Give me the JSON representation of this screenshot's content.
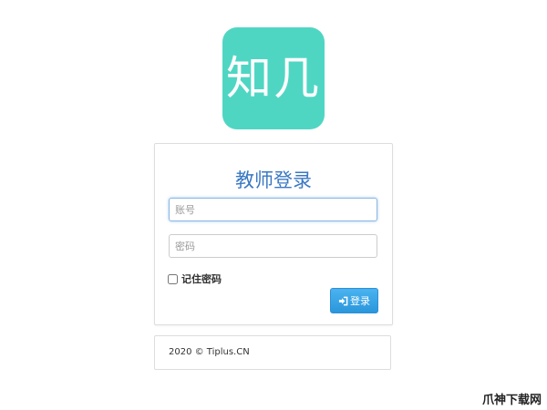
{
  "logo": {
    "text": "知几",
    "color": "#4fd6c3"
  },
  "login": {
    "title": "教师登录",
    "account_placeholder": "账号",
    "password_placeholder": "密码",
    "remember_label": "记住密码",
    "remember_checked": false,
    "button_label": "登录",
    "button_icon": "sign-in-icon",
    "accent_color": "#2a96dc"
  },
  "footer": {
    "text": "2020 © Tiplus.CN"
  },
  "watermark": {
    "text": "爪神下载网"
  }
}
